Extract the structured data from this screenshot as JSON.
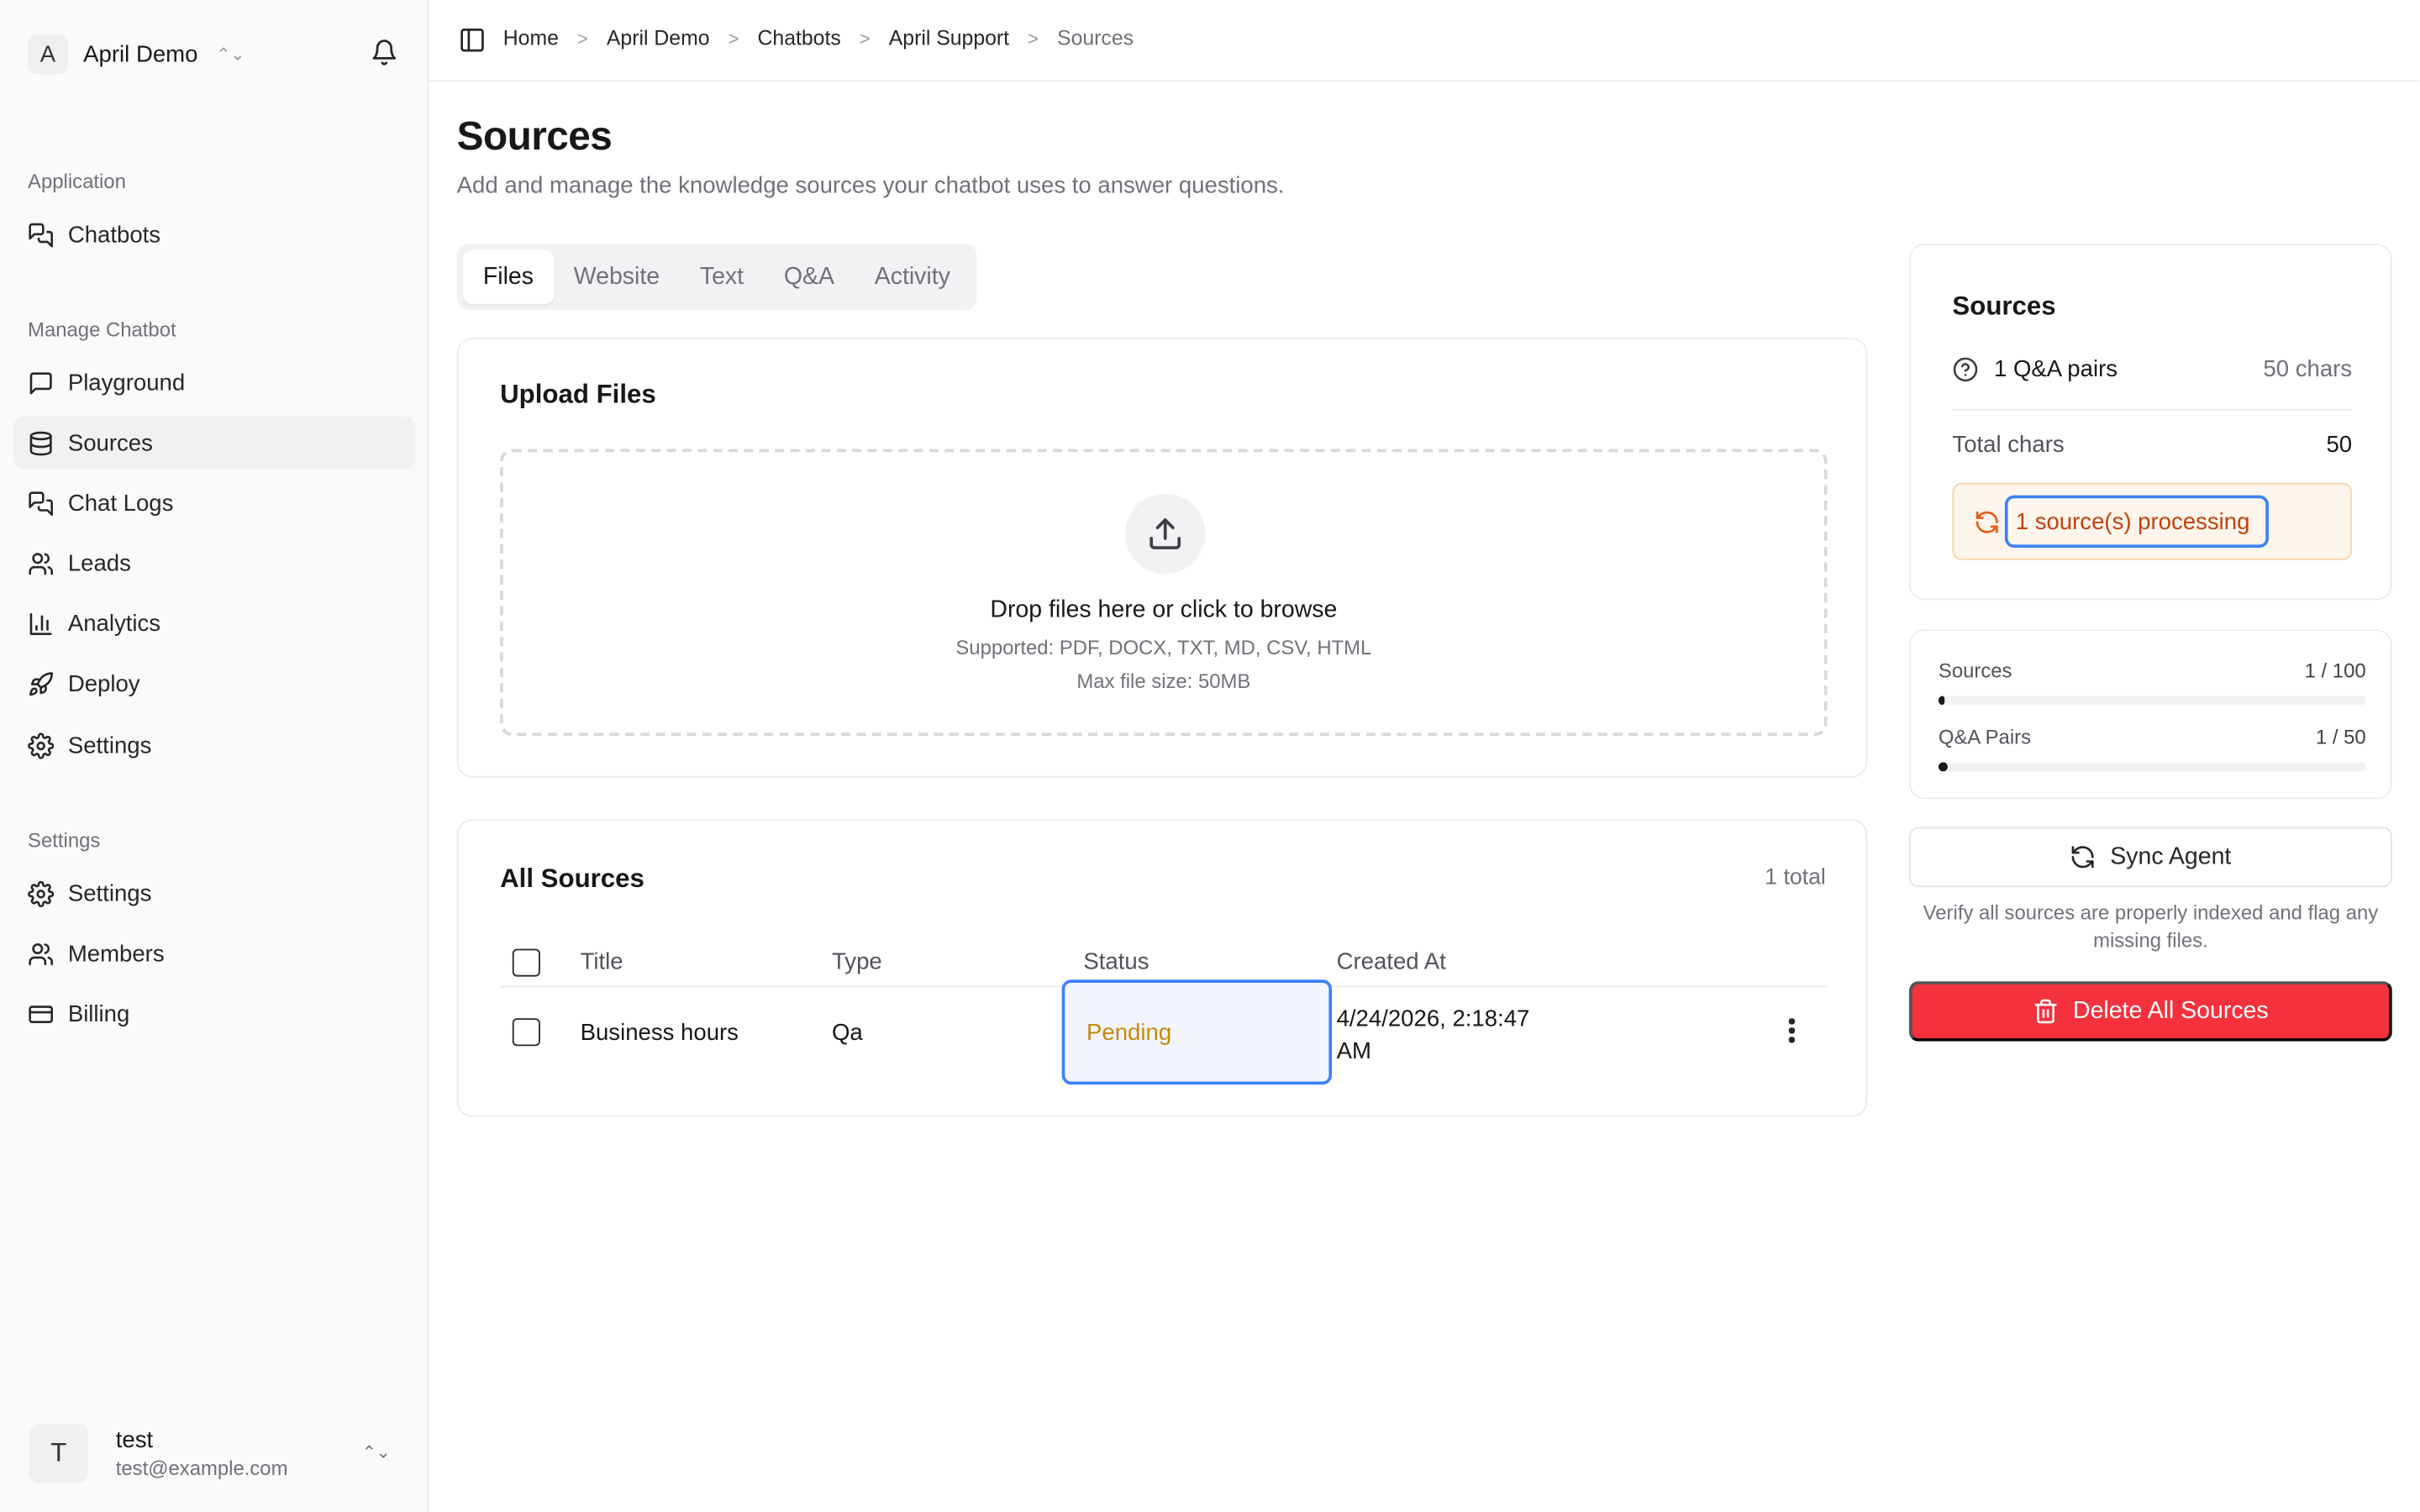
{
  "team": {
    "initial": "A",
    "name": "April Demo"
  },
  "nav": {
    "application_label": "Application",
    "chatbots": "Chatbots",
    "manage_label": "Manage Chatbot",
    "playground": "Playground",
    "sources": "Sources",
    "chat_logs": "Chat Logs",
    "leads": "Leads",
    "analytics": "Analytics",
    "deploy": "Deploy",
    "settings": "Settings",
    "settings_group_label": "Settings",
    "settings2": "Settings",
    "members": "Members",
    "billing": "Billing"
  },
  "user": {
    "initial": "T",
    "name": "test",
    "email": "test@example.com"
  },
  "breadcrumb": [
    "Home",
    "April Demo",
    "Chatbots",
    "April Support",
    "Sources"
  ],
  "page": {
    "title": "Sources",
    "subtitle": "Add and manage the knowledge sources your chatbot uses to answer questions."
  },
  "tabs": [
    "Files",
    "Website",
    "Text",
    "Q&A",
    "Activity"
  ],
  "upload": {
    "title": "Upload Files",
    "drop_title": "Drop files here or click to browse",
    "supported": "Supported: PDF, DOCX, TXT, MD, CSV, HTML",
    "max_size": "Max file size: 50MB"
  },
  "all_sources": {
    "title": "All Sources",
    "total": "1 total",
    "columns": [
      "Title",
      "Type",
      "Status",
      "Created At"
    ],
    "rows": [
      {
        "title": "Business hours",
        "type": "Qa",
        "status": "Pending",
        "created_line1": "4/24/2026, 2:18:47",
        "created_line2": "AM"
      }
    ]
  },
  "summary": {
    "title": "Sources",
    "qa_label": "1 Q&A pairs",
    "qa_value": "50 chars",
    "total_label": "Total chars",
    "total_value": "50",
    "processing": "1 source(s) processing"
  },
  "usage": {
    "sources_label": "Sources",
    "sources_value": "1 / 100",
    "sources_fraction": 0.01,
    "qa_label": "Q&A Pairs",
    "qa_value": "1 / 50",
    "qa_fraction": 0.02
  },
  "actions": {
    "sync": "Sync Agent",
    "sync_note": "Verify all sources are properly indexed and flag any missing files.",
    "delete": "Delete All Sources"
  },
  "colors": {
    "danger": "#f4313c",
    "pending": "#c8870b",
    "processing_text": "#c2410c",
    "focus": "#3b82f6"
  }
}
